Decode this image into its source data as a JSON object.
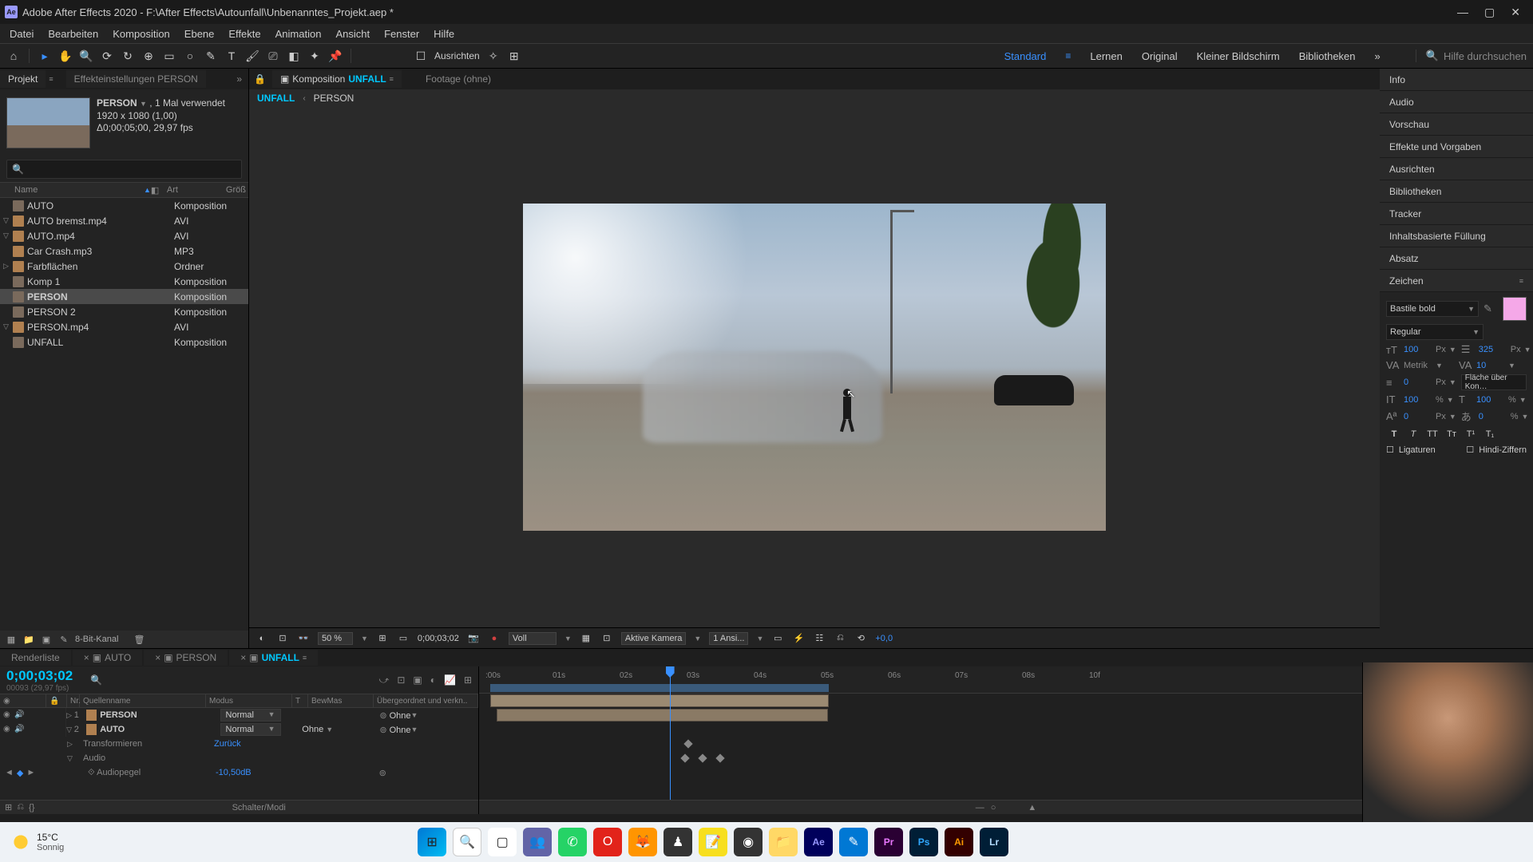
{
  "titlebar": {
    "text": "Adobe After Effects 2020 - F:\\After Effects\\Autounfall\\Unbenanntes_Projekt.aep *"
  },
  "menu": [
    "Datei",
    "Bearbeiten",
    "Komposition",
    "Ebene",
    "Effekte",
    "Animation",
    "Ansicht",
    "Fenster",
    "Hilfe"
  ],
  "toolbar": {
    "align": "Ausrichten"
  },
  "workspaces": {
    "items": [
      "Standard",
      "Lernen",
      "Original",
      "Kleiner Bildschirm",
      "Bibliotheken"
    ],
    "active": 0,
    "search_ph": "Hilfe durchsuchen"
  },
  "project_panel": {
    "tab1": "Projekt",
    "tab2": "Effekteinstellungen PERSON",
    "meta_name": "PERSON",
    "meta_used": " , 1 Mal verwendet",
    "meta_dim": "1920 x 1080 (1,00)",
    "meta_dur": "Δ0;00;05;00, 29,97 fps",
    "cols": {
      "name": "Name",
      "tag": "",
      "art": "Art",
      "grob": "Größ"
    },
    "items": [
      {
        "name": "AUTO",
        "art": "Komposition",
        "icon": "comp",
        "toggle": ""
      },
      {
        "name": "AUTO bremst.mp4",
        "art": "AVI",
        "icon": "vid",
        "toggle": "▽"
      },
      {
        "name": "AUTO.mp4",
        "art": "AVI",
        "icon": "vid",
        "toggle": "▽"
      },
      {
        "name": "Car Crash.mp3",
        "art": "MP3",
        "icon": "aud",
        "toggle": ""
      },
      {
        "name": "Farbflächen",
        "art": "Ordner",
        "icon": "fold",
        "toggle": "▷"
      },
      {
        "name": "Komp 1",
        "art": "Komposition",
        "icon": "comp",
        "toggle": ""
      },
      {
        "name": "PERSON",
        "art": "Komposition",
        "icon": "comp",
        "toggle": "",
        "selected": true,
        "bold": true
      },
      {
        "name": "PERSON 2",
        "art": "Komposition",
        "icon": "comp",
        "toggle": ""
      },
      {
        "name": "PERSON.mp4",
        "art": "AVI",
        "icon": "vid",
        "toggle": "▽"
      },
      {
        "name": "UNFALL",
        "art": "Komposition",
        "icon": "comp",
        "toggle": ""
      }
    ],
    "footer_bpc": "8-Bit-Kanal"
  },
  "comp_panel": {
    "tab_label": "Komposition",
    "tab_name": "UNFALL",
    "footage_label": "Footage",
    "footage_value": "(ohne)",
    "crumbs": [
      "UNFALL",
      "PERSON"
    ]
  },
  "viewer_footer": {
    "zoom": "50 %",
    "tc": "0;00;03;02",
    "res": "Voll",
    "cam": "Aktive Kamera",
    "views": "1 Ansi...",
    "exposure": "+0,0"
  },
  "right_panels": [
    "Info",
    "Audio",
    "Vorschau",
    "Effekte und Vorgaben",
    "Ausrichten",
    "Bibliotheken",
    "Tracker",
    "Inhaltsbasierte Füllung",
    "Absatz"
  ],
  "char": {
    "title": "Zeichen",
    "font": "Bastile bold",
    "style": "Regular",
    "size": "100",
    "size_u": "Px",
    "leading": "325",
    "leading_u": "Px",
    "kern": "Metrik",
    "track": "10",
    "stroke": "0",
    "stroke_u": "Px",
    "fill_label": "Fläche über Kon…",
    "vscale": "100",
    "vscale_u": "%",
    "hscale": "100",
    "hscale_u": "%",
    "baseline": "0",
    "baseline_u": "Px",
    "tsume": "0",
    "tsume_u": "%",
    "lig": "Ligaturen",
    "hindi": "Hindi-Ziffern"
  },
  "timeline": {
    "tabs": [
      {
        "name": "Renderliste",
        "type": "plain"
      },
      {
        "name": "AUTO",
        "type": "comp"
      },
      {
        "name": "PERSON",
        "type": "comp"
      },
      {
        "name": "UNFALL",
        "type": "comp",
        "active": true
      }
    ],
    "tc": "0;00;03;02",
    "tc_sub": "00093 (29,97 fps)",
    "cols": {
      "nr": "Nr.",
      "qn": "Quellenname",
      "modus": "Modus",
      "t": "T",
      "bw": "BewMas",
      "par": "Übergeordnet und verkn.."
    },
    "layers": [
      {
        "idx": "1",
        "name": "PERSON",
        "mode": "Normal",
        "bw": "",
        "par": "Ohne",
        "toggle": "▷"
      },
      {
        "idx": "2",
        "name": "AUTO",
        "mode": "Normal",
        "bw": "Ohne",
        "par": "Ohne",
        "toggle": "▽",
        "expanded": true
      }
    ],
    "sub1": "Transformieren",
    "sub1_val": "Zurück",
    "sub2": "Audio",
    "sub3": "Audiopegel",
    "sub3_val": "-10,50dB",
    "switch_label": "Schalter/Modi",
    "ruler": [
      ":00s",
      "01s",
      "02s",
      "03s",
      "04s",
      "05s",
      "06s",
      "07s",
      "08s",
      "10f"
    ],
    "playhead_pct": 30.5
  },
  "taskbar": {
    "temp": "15°C",
    "cond": "Sonnig"
  }
}
